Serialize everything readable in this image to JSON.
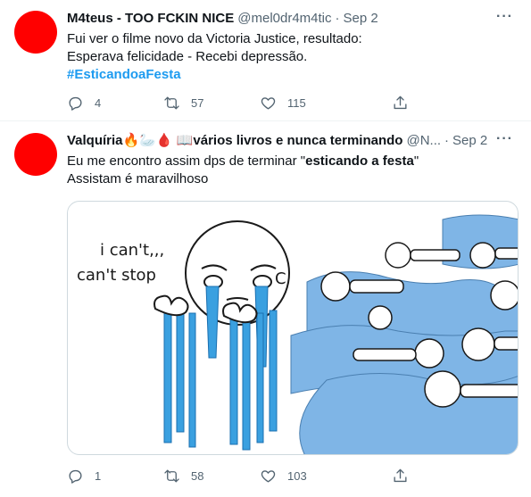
{
  "tweets": [
    {
      "name": "M4teus - TOO FCKIN NICE",
      "handle": "@mel0dr4m4tic",
      "dot": "·",
      "time": "Sep 2",
      "more_icon": "more-icon",
      "text_lines": [
        "Fui ver o filme novo da Victoria Justice, resultado:",
        "Esperava felicidade - Recebi depressão."
      ],
      "hashtag": "#EsticandoaFesta",
      "replies": "4",
      "retweets": "57",
      "likes": "115",
      "avatar_color": "#ff0000"
    },
    {
      "name": "Valquíria🔥🦢🩸 📖vários livros e nunca terminando",
      "handle": "@N...",
      "dot": "·",
      "time": "Sep 2",
      "text_line1_prefix": "Eu me encontro assim dps de terminar \"",
      "text_line1_bold": "esticando a festa",
      "text_line1_suffix": "\"",
      "text_line2": "Assistam é maravilhoso",
      "media": {
        "left_caption_1": "i can't,,,",
        "left_caption_2": "can't stop",
        "left_caption_3": "C"
      },
      "replies": "1",
      "retweets": "58",
      "likes": "103",
      "avatar_color": "#ff0000"
    }
  ],
  "colors": {
    "accent": "#1d9bf0",
    "muted": "#536471",
    "tears": "#3aa0e0"
  }
}
